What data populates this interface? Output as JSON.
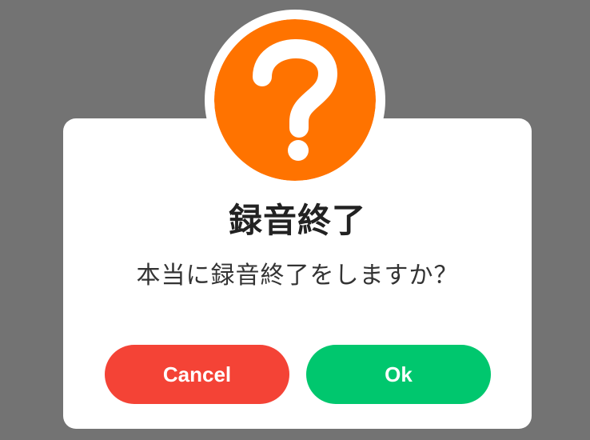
{
  "dialog": {
    "icon": "question-mark-icon",
    "title": "録音終了",
    "message": "本当に録音終了をしますか？",
    "cancel_label": "Cancel",
    "ok_label": "Ok"
  },
  "colors": {
    "overlay": "#737373",
    "dialog_background": "#ffffff",
    "icon_background": "#ff7300",
    "cancel_button": "#f44336",
    "ok_button": "#00c76e"
  }
}
